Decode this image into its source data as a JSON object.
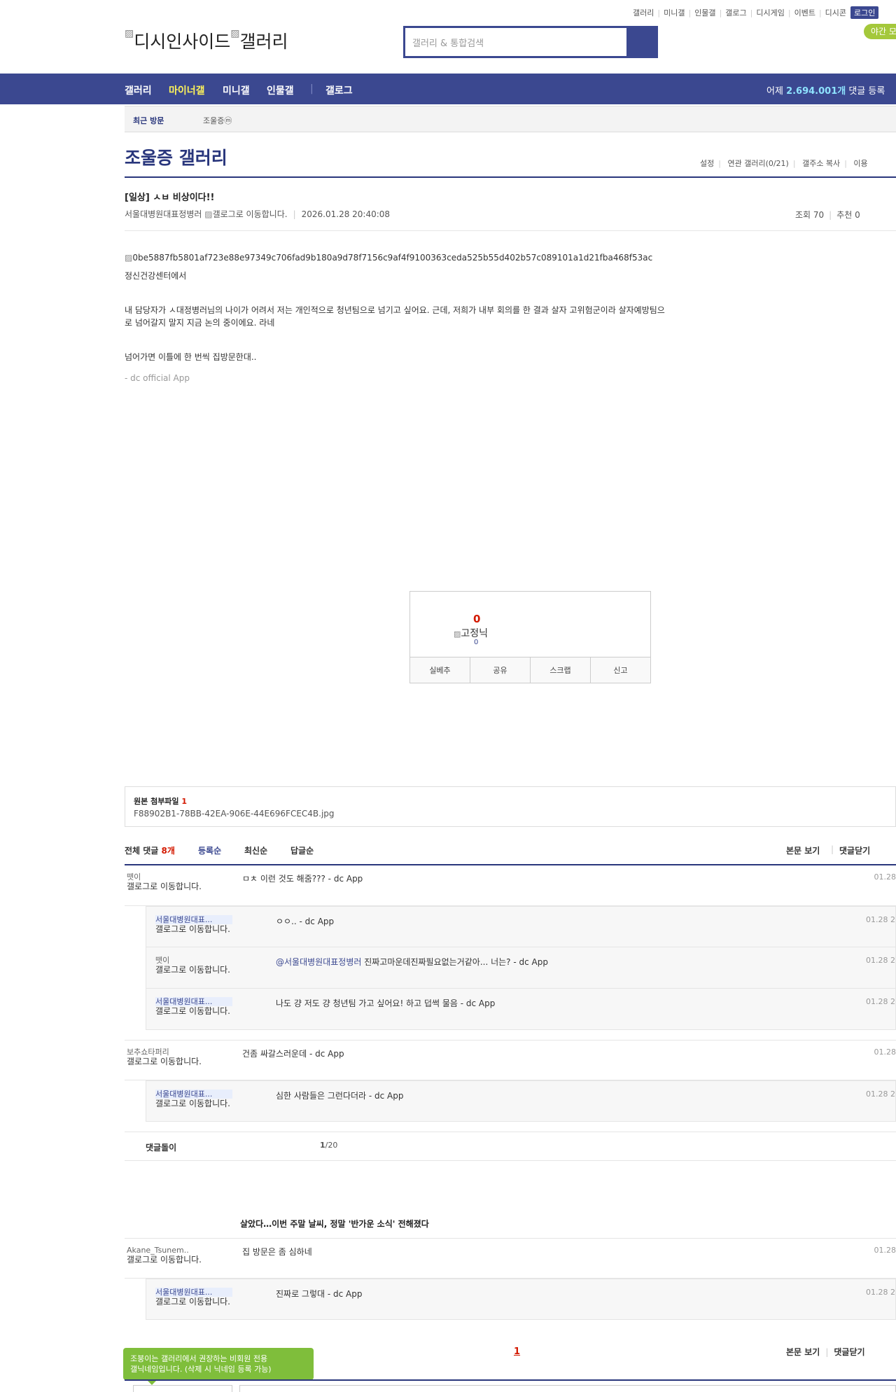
{
  "topmenu": {
    "items": [
      "갤러리",
      "미니갤",
      "인물갤",
      "갤로그",
      "디시게임",
      "이벤트",
      "디시콘"
    ],
    "login": "로그인"
  },
  "header": {
    "logo": "디시인사이드",
    "logo2": "갤러리",
    "search_placeholder": "갤러리 & 통합검색",
    "night": "야간 모"
  },
  "gnb": {
    "items": [
      "갤러리",
      "마이너갤",
      "미니갤",
      "인물갤",
      "갤로그"
    ],
    "stat_prefix": "어제 ",
    "stat_value": "2.694.001개",
    "stat_suffix": " 댓글 등록"
  },
  "visit": {
    "label": "최근 방문",
    "gallery": "조울증ⓜ"
  },
  "gallery": {
    "title": "조울증 갤러리",
    "menu": [
      "설정",
      "연관 갤러리(0/21)",
      "갤주소 복사",
      "이용"
    ]
  },
  "post": {
    "title": "[일상] ㅅㅂ 비상이다!!",
    "author": "서울대병원대표정병러",
    "gallog_alt": "갤로그로 이동합니다.",
    "date": "2026.01.28 20:40:08",
    "views": "조회 70",
    "recommend": "추천 0",
    "image_alt": "0be5887fb5801af723e88e97349c706fad9b180a9d78f7156c9af4f9100363ceda525b55d402b57c089101a1d21fba468f53ac",
    "p1": "정신건강센터에서",
    "p2": "내 담당자가 ㅅ대정병러님의 나이가 어려서 저는 개인적으로 청년팀으로 넘기고 싶어요. 근데, 저희가 내부 회의를 한 결과 살자 고위험군이라 살자예방팀으",
    "p3": "로 넘어갈지 말지 지금 논의 중이에요. 라네",
    "p4": "넘어가면 이틀에 한 번씩 집방문한대..",
    "source": "- dc official App"
  },
  "rec": {
    "count": "0",
    "nick": "고정닉",
    "fixed_count": "0",
    "buttons": [
      "실베추",
      "공유",
      "스크랩",
      "신고"
    ]
  },
  "attach": {
    "label": "원본 첨부파일",
    "count": "1",
    "file": "F88902B1-78BB-42EA-906E-44E696FCEC4B.jpg"
  },
  "comments": {
    "label": "전체 댓글",
    "count": "8개",
    "sorts": [
      "등록순",
      "최신순",
      "답글순"
    ],
    "view_body": "본문 보기",
    "close": "댓글닫기",
    "gallog": "갤로그로 이동합니다.",
    "list": [
      {
        "nick": "뗏이",
        "text": "ㅁㅊ 이런 것도 해줌??? - dc App",
        "date": "01.28"
      },
      {
        "nick": "서울대병원대표...",
        "text": "ㅇㅇ.. - dc App",
        "date": "01.28 2"
      },
      {
        "nick": "뗏이",
        "mention": "@서울대병원대표정병러",
        "text": " 진짜고마운데진짜필요없는거같아... 너는? - dc App",
        "date": "01.28 2"
      },
      {
        "nick": "서울대병원대표...",
        "text": "나도 걍 저도 걍 청년팀 가고 싶어요! 하고 덥썩 물음 - dc App",
        "date": "01.28 2"
      },
      {
        "nick": "보추쇼타퍼리",
        "text": "건좀 싸갈스러운데 - dc App",
        "date": "01.28"
      },
      {
        "nick": "서울대병원대표...",
        "text": "심한 사람들은 그런다더라 - dc App",
        "date": "01.28 2"
      },
      {
        "nick": "Akane_Tsunem..",
        "text": "집 방문은 좀 심하네",
        "date": "01.28"
      },
      {
        "nick": "서울대병원대표...",
        "text": "진짜로 그렇대 - dc App",
        "date": "01.28 2"
      }
    ],
    "bot": "댓글돌이",
    "page_current": "1",
    "page_total": "/20"
  },
  "ad": {
    "title": "살았다…이번 주말 날씨, 정말 '반가운 소식' 전해졌다"
  },
  "paging": {
    "current": "1"
  },
  "tip": {
    "line1": "조붕이는 갤러리에서 권장하는 비회원 전용",
    "line2": "갤닉네임입니다. (삭제 시 닉네임 등록 가능)"
  }
}
